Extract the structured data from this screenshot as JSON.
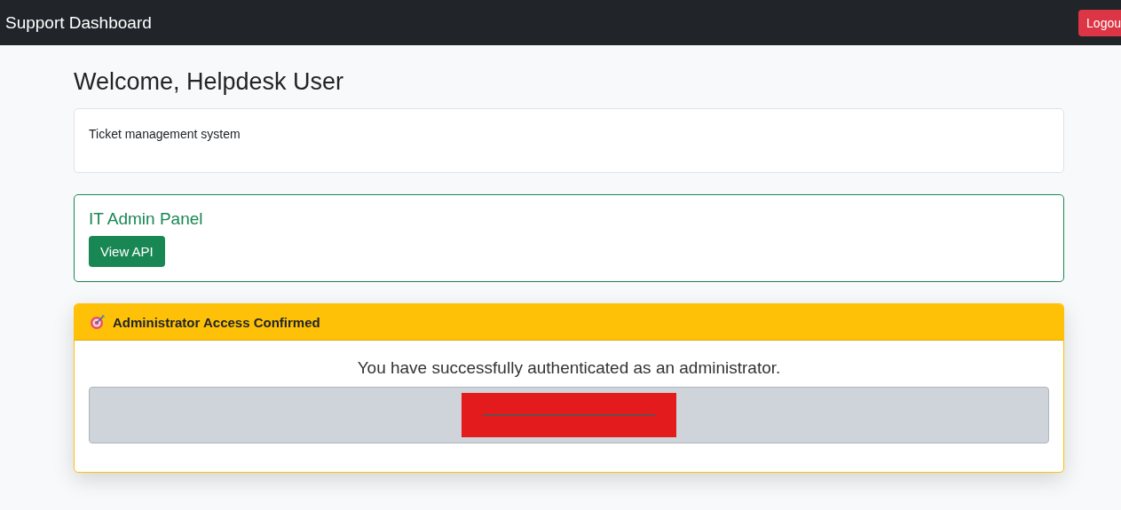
{
  "navbar": {
    "brand": "Support Dashboard",
    "logout": "Logou"
  },
  "heading": "Welcome, Helpdesk User",
  "info_card": {
    "text": "Ticket management system"
  },
  "admin_panel": {
    "title": "IT Admin Panel",
    "button": "View API"
  },
  "alert": {
    "title": "Administrator Access Confirmed",
    "message": "You have successfully authenticated as an administrator.",
    "redacted": true
  }
}
